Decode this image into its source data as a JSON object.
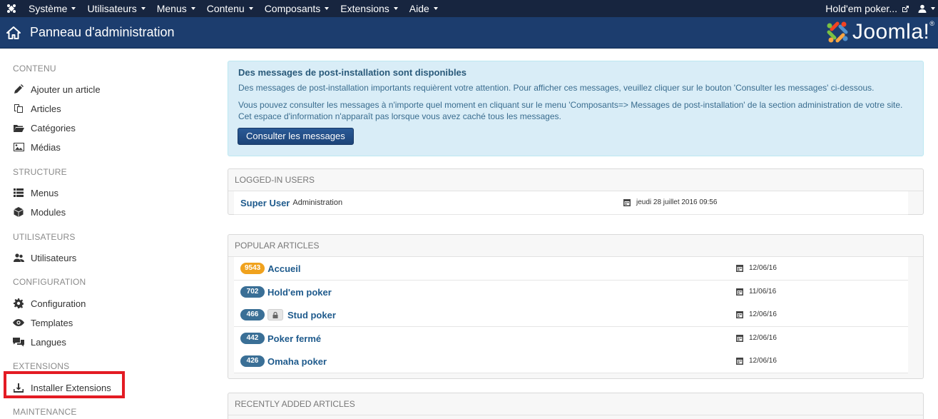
{
  "navbar": {
    "menus": [
      {
        "label": "Système"
      },
      {
        "label": "Utilisateurs"
      },
      {
        "label": "Menus"
      },
      {
        "label": "Contenu"
      },
      {
        "label": "Composants"
      },
      {
        "label": "Extensions"
      },
      {
        "label": "Aide"
      }
    ],
    "site_link": "Hold'em poker...",
    "user_icon": "user-icon"
  },
  "subhead": {
    "title": "Panneau d'administration",
    "logo_text": "Joomla!",
    "logo_reg": "®"
  },
  "sidebar": {
    "sections": [
      {
        "heading": "CONTENU",
        "items": [
          {
            "label": "Ajouter un article",
            "icon": "pencil-icon"
          },
          {
            "label": "Articles",
            "icon": "copy-icon"
          },
          {
            "label": "Catégories",
            "icon": "folder-icon"
          },
          {
            "label": "Médias",
            "icon": "image-icon"
          }
        ]
      },
      {
        "heading": "STRUCTURE",
        "items": [
          {
            "label": "Menus",
            "icon": "list-icon"
          },
          {
            "label": "Modules",
            "icon": "cube-icon"
          }
        ]
      },
      {
        "heading": "UTILISATEURS",
        "items": [
          {
            "label": "Utilisateurs",
            "icon": "users-icon"
          }
        ]
      },
      {
        "heading": "CONFIGURATION",
        "items": [
          {
            "label": "Configuration",
            "icon": "gear-icon"
          },
          {
            "label": "Templates",
            "icon": "eye-icon"
          },
          {
            "label": "Langues",
            "icon": "comments-icon"
          }
        ]
      },
      {
        "heading": "EXTENSIONS",
        "items": [
          {
            "label": "Installer Extensions",
            "icon": "download-icon"
          }
        ]
      },
      {
        "heading": "MAINTENANCE",
        "items": []
      }
    ],
    "highlight_color": "#e31b23"
  },
  "alert": {
    "title": "Des messages de post-installation sont disponibles",
    "para1": "Des messages de post-installation importants requièrent votre attention. Pour afficher ces messages, veuillez cliquer sur le bouton 'Consulter les messages' ci-dessous.",
    "para2": "Vous pouvez consulter les messages à n'importe quel moment en cliquant sur le menu 'Composants=> Messages de post-installation' de la section administration de votre site. Cet espace d'information n'apparaît pas lorsque vous avez caché tous les messages.",
    "button": "Consulter les messages"
  },
  "logged_in": {
    "title": "LOGGED-IN USERS",
    "rows": [
      {
        "name": "Super User",
        "area": "Administration",
        "date": "jeudi 28 juillet 2016 09:56"
      }
    ]
  },
  "popular": {
    "title": "POPULAR ARTICLES",
    "rows": [
      {
        "hits": "9543",
        "title": "Accueil",
        "date": "12/06/16",
        "locked": false,
        "badge_color": "#f0a21e"
      },
      {
        "hits": "702",
        "title": "Hold'em poker",
        "date": "11/06/16",
        "locked": false,
        "badge_color": "#3a6f96"
      },
      {
        "hits": "466",
        "title": "Stud poker",
        "date": "12/06/16",
        "locked": true,
        "badge_color": "#3a6f96"
      },
      {
        "hits": "442",
        "title": "Poker fermé",
        "date": "12/06/16",
        "locked": false,
        "badge_color": "#3a6f96"
      },
      {
        "hits": "426",
        "title": "Omaha poker",
        "date": "12/06/16",
        "locked": false,
        "badge_color": "#3a6f96"
      }
    ]
  },
  "recent": {
    "title": "RECENTLY ADDED ARTICLES"
  }
}
